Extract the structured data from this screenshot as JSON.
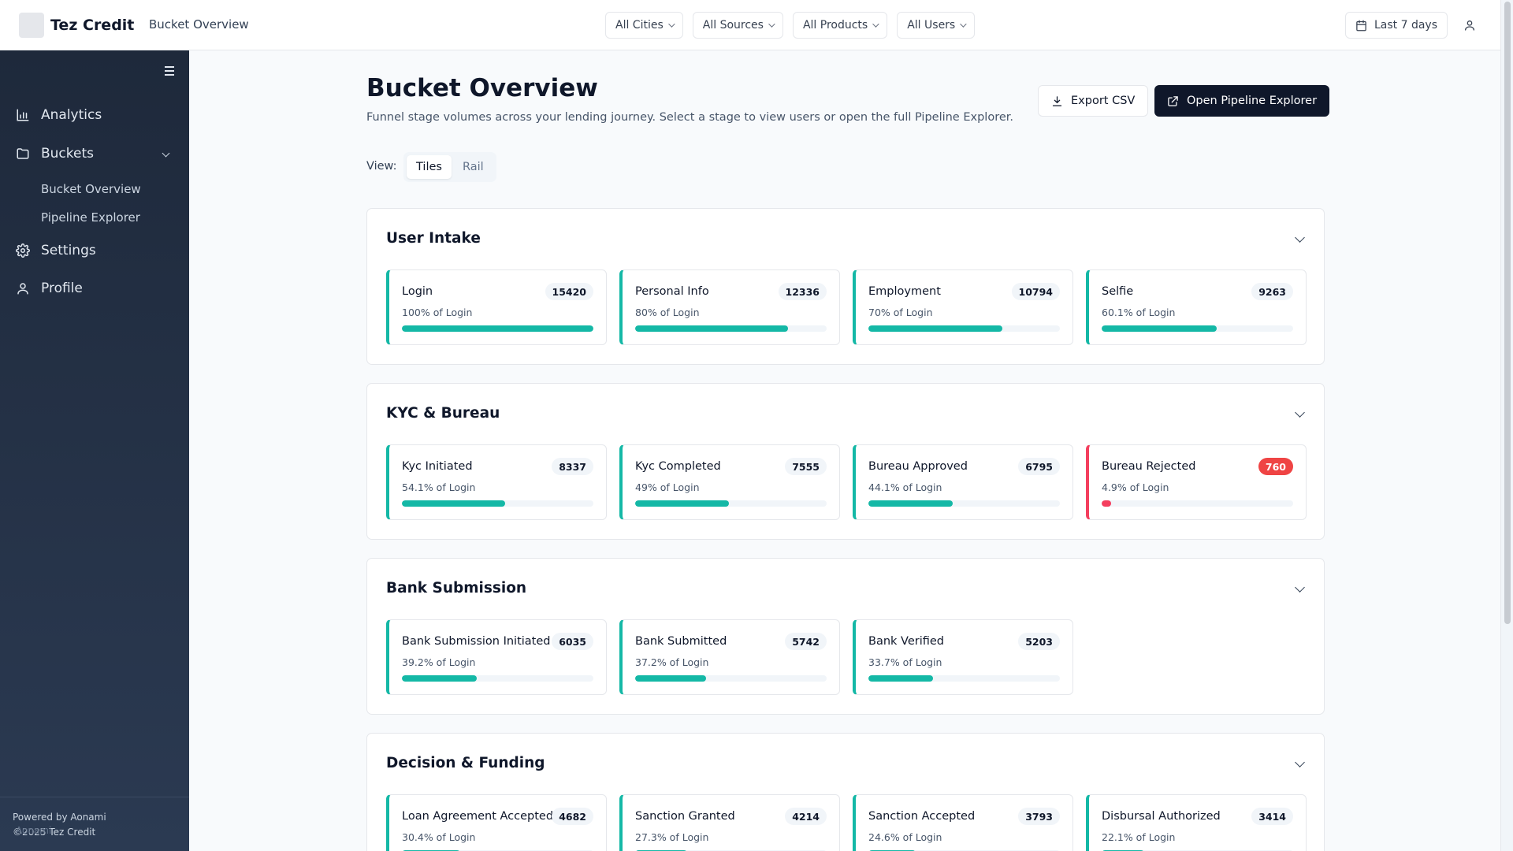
{
  "header": {
    "brand": "Tez Credit",
    "breadcrumb": "Bucket Overview",
    "filters": [
      "All Cities",
      "All Sources",
      "All Products",
      "All Users"
    ],
    "date_range": "Last 7 days"
  },
  "sidebar": {
    "items": [
      {
        "label": "Analytics",
        "icon": "bar-chart-icon"
      },
      {
        "label": "Buckets",
        "icon": "folder-icon"
      },
      {
        "label": "Settings",
        "icon": "gear-icon"
      },
      {
        "label": "Profile",
        "icon": "user-icon"
      }
    ],
    "sub_items": [
      "Bucket Overview",
      "Pipeline Explorer"
    ],
    "footer": {
      "powered_by": "Powered by Aonami",
      "copyright": "©2025 Tez Credit",
      "ghost": "Aonami"
    }
  },
  "page": {
    "title": "Bucket Overview",
    "subtitle": "Funnel stage volumes across your lending journey. Select a stage to view users or open the full Pipeline Explorer.",
    "export_label": "Export CSV",
    "open_label": "Open Pipeline Explorer",
    "view_label": "View:",
    "view_options": [
      "Tiles",
      "Rail"
    ],
    "active_view": "Tiles"
  },
  "colors": {
    "accent": "#14b8a6",
    "reject": "#f43f5e",
    "primary_button": "#0f172a"
  },
  "sections": [
    {
      "title": "User Intake",
      "tiles": [
        {
          "name": "Login",
          "count": "15420",
          "pct_label": "100% of Login",
          "fraction": 1.0,
          "status": "ok"
        },
        {
          "name": "Personal Info",
          "count": "12336",
          "pct_label": "80% of Login",
          "fraction": 0.8,
          "status": "ok"
        },
        {
          "name": "Employment",
          "count": "10794",
          "pct_label": "70% of Login",
          "fraction": 0.7,
          "status": "ok"
        },
        {
          "name": "Selfie",
          "count": "9263",
          "pct_label": "60.1% of Login",
          "fraction": 0.601,
          "status": "ok"
        }
      ]
    },
    {
      "title": "KYC & Bureau",
      "tiles": [
        {
          "name": "Kyc Initiated",
          "count": "8337",
          "pct_label": "54.1% of Login",
          "fraction": 0.541,
          "status": "ok"
        },
        {
          "name": "Kyc Completed",
          "count": "7555",
          "pct_label": "49% of Login",
          "fraction": 0.49,
          "status": "ok"
        },
        {
          "name": "Bureau Approved",
          "count": "6795",
          "pct_label": "44.1% of Login",
          "fraction": 0.441,
          "status": "ok"
        },
        {
          "name": "Bureau Rejected",
          "count": "760",
          "pct_label": "4.9% of Login",
          "fraction": 0.049,
          "status": "reject"
        }
      ]
    },
    {
      "title": "Bank Submission",
      "tiles": [
        {
          "name": "Bank Submission Initiated",
          "count": "6035",
          "pct_label": "39.2% of Login",
          "fraction": 0.392,
          "status": "ok"
        },
        {
          "name": "Bank Submitted",
          "count": "5742",
          "pct_label": "37.2% of Login",
          "fraction": 0.372,
          "status": "ok"
        },
        {
          "name": "Bank Verified",
          "count": "5203",
          "pct_label": "33.7% of Login",
          "fraction": 0.337,
          "status": "ok"
        }
      ]
    },
    {
      "title": "Decision & Funding",
      "tiles": [
        {
          "name": "Loan Agreement Accepted",
          "count": "4682",
          "pct_label": "30.4% of Login",
          "fraction": 0.304,
          "status": "ok"
        },
        {
          "name": "Sanction Granted",
          "count": "4214",
          "pct_label": "27.3% of Login",
          "fraction": 0.273,
          "status": "ok"
        },
        {
          "name": "Sanction Accepted",
          "count": "3793",
          "pct_label": "24.6% of Login",
          "fraction": 0.246,
          "status": "ok"
        },
        {
          "name": "Disbursal Authorized",
          "count": "3414",
          "pct_label": "22.1% of Login",
          "fraction": 0.221,
          "status": "ok"
        }
      ]
    }
  ]
}
